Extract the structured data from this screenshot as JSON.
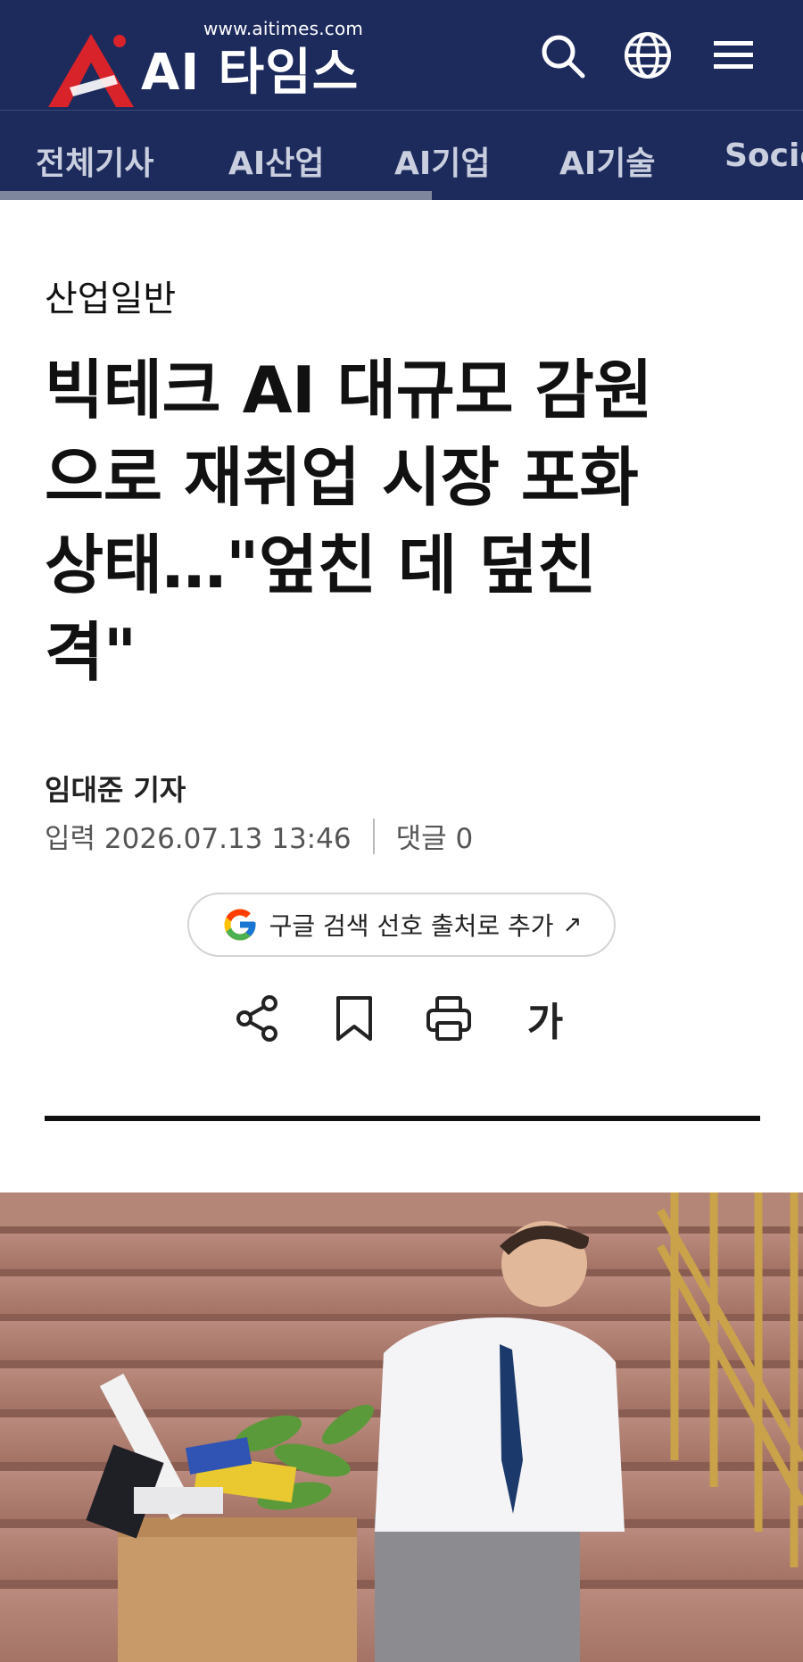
{
  "header": {
    "url": "www.aitimes.com",
    "logo_text": "AI 타임스",
    "icons": [
      "search-icon",
      "globe-icon",
      "menu-icon"
    ],
    "bg_color": "#1c2a5c",
    "accent_color": "#d8232a"
  },
  "nav": {
    "items": [
      "전체기사",
      "AI산업",
      "AI기업",
      "AI기술",
      "Socie"
    ]
  },
  "article": {
    "section": "산업일반",
    "headline_lines": [
      "빅테크 AI 대규모 감원",
      "으로 재취업 시장 포화",
      "상태…\"엎친 데 덮친",
      "격\""
    ],
    "author": "임대준 기자",
    "published": "입력 2026.07.13 13:46",
    "comments": "댓글 0"
  },
  "google_pill": {
    "label": "구글 검색 선호 출처로 추가",
    "arrow": "↗"
  },
  "actions": {
    "icons": [
      "share-icon",
      "bookmark-icon",
      "print-icon",
      "font-size-icon"
    ],
    "font_label": "가"
  }
}
